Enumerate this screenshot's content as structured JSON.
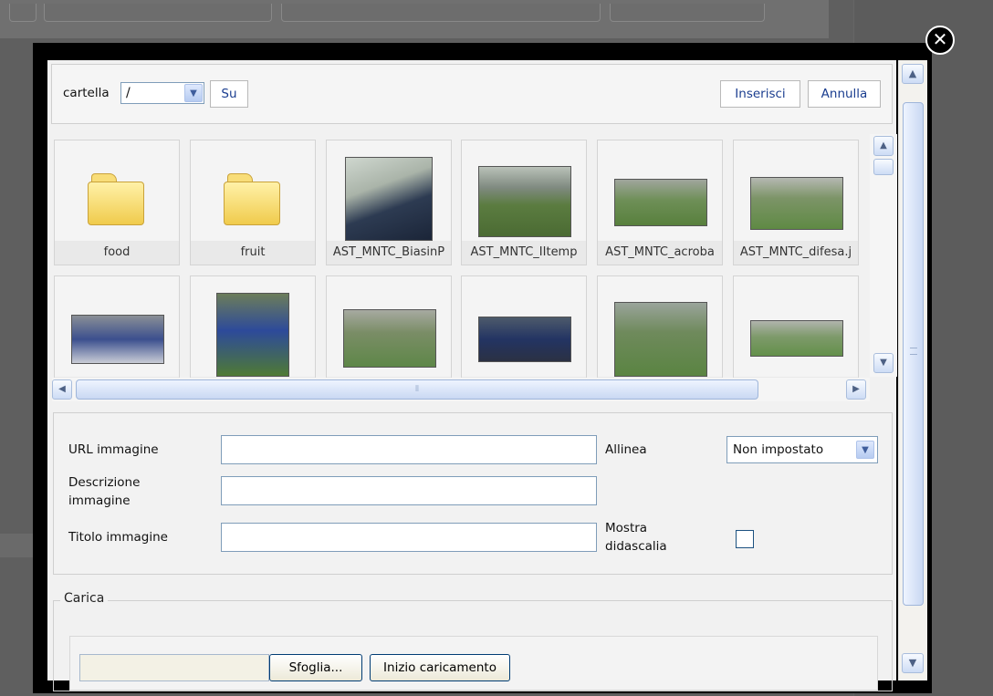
{
  "toolbar": {
    "folder_label": "cartella",
    "folder_value": "/",
    "up_label": "Su",
    "insert_label": "Inserisci",
    "cancel_label": "Annulla"
  },
  "files": [
    {
      "name": "food",
      "type": "folder"
    },
    {
      "name": "fruit",
      "type": "folder"
    },
    {
      "name": "AST_MNTC_BiasinP",
      "type": "image"
    },
    {
      "name": "AST_MNTC_IItemp",
      "type": "image"
    },
    {
      "name": "AST_MNTC_acroba",
      "type": "image"
    },
    {
      "name": "AST_MNTC_difesa.j",
      "type": "image"
    },
    {
      "name": "",
      "type": "image"
    },
    {
      "name": "",
      "type": "image"
    },
    {
      "name": "",
      "type": "image"
    },
    {
      "name": "",
      "type": "image"
    },
    {
      "name": "",
      "type": "image"
    },
    {
      "name": "",
      "type": "image"
    }
  ],
  "form": {
    "url_label": "URL immagine",
    "desc_label": "Descrizione immagine",
    "title_label": "Titolo immagine",
    "align_label": "Allinea",
    "align_value": "Non impostato",
    "caption_label": "Mostra didascalia",
    "url_value": "",
    "desc_value": "",
    "title_value": ""
  },
  "upload": {
    "legend": "Carica",
    "browse_label": "Sfoglia...",
    "start_label": "Inizio caricamento"
  },
  "icons": {
    "close": "close-icon",
    "folder": "folder-icon",
    "dropdown": "chevron-down-icon",
    "scroll_up": "arrow-up-icon",
    "scroll_down": "arrow-down-icon",
    "scroll_left": "arrow-left-icon",
    "scroll_right": "arrow-right-icon"
  }
}
